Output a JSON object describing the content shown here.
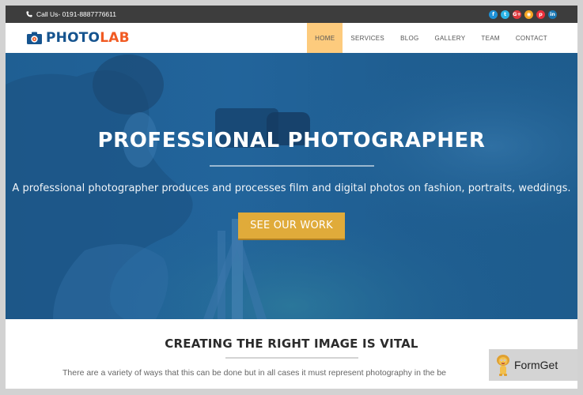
{
  "topbar": {
    "call_text": "Call Us- 0191-8887776611",
    "phone_icon": "phone-icon",
    "socials": [
      {
        "name": "facebook",
        "glyph": "f",
        "color": "#1e90d6"
      },
      {
        "name": "twitter",
        "glyph": "t",
        "color": "#2bb5e8"
      },
      {
        "name": "google-plus",
        "glyph": "G+",
        "color": "#e0393e"
      },
      {
        "name": "rss",
        "glyph": "◉",
        "color": "#f5a623"
      },
      {
        "name": "pinterest",
        "glyph": "p",
        "color": "#e8303a"
      },
      {
        "name": "linkedin",
        "glyph": "in",
        "color": "#1a78b4"
      }
    ]
  },
  "brand": {
    "logo_icon": "camera-icon",
    "name_part1": "PHOTO",
    "name_part2": "LAB",
    "color_primary": "#16548f",
    "color_accent": "#f15a22"
  },
  "nav": {
    "items": [
      {
        "label": "HOME",
        "active": true
      },
      {
        "label": "SERVICES",
        "active": false
      },
      {
        "label": "BLOG",
        "active": false
      },
      {
        "label": "GALLERY",
        "active": false
      },
      {
        "label": "TEAM",
        "active": false
      },
      {
        "label": "CONTACT",
        "active": false
      }
    ],
    "active_color": "#fdcb7d"
  },
  "hero": {
    "title": "PROFESSIONAL PHOTOGRAPHER",
    "subtitle": "A professional photographer produces and processes film and digital photos on fashion, portraits, weddings.",
    "button_label": "SEE OUR WORK",
    "button_color": "#e0ab3a",
    "overlay_color": "#1f5f93"
  },
  "section": {
    "title": "CREATING THE RIGHT IMAGE IS VITAL",
    "text": "There are a variety of ways that this can be done but in all cases it must represent photography in the be"
  },
  "badge": {
    "label": "FormGet",
    "icon": "lion-mascot-icon"
  }
}
